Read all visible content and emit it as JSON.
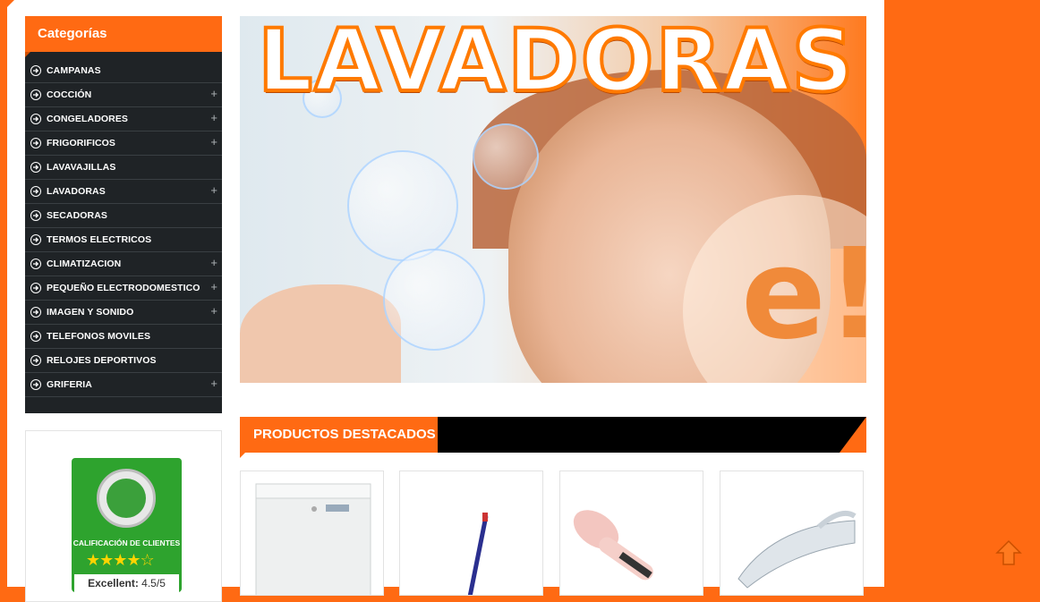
{
  "sidebar": {
    "title": "Categorías",
    "items": [
      {
        "label": "CAMPANAS",
        "expandable": false
      },
      {
        "label": "COCCIÓN",
        "expandable": true
      },
      {
        "label": "CONGELADORES",
        "expandable": true
      },
      {
        "label": "FRIGORIFICOS",
        "expandable": true
      },
      {
        "label": "LAVAVAJILLAS",
        "expandable": false
      },
      {
        "label": "LAVADORAS",
        "expandable": true
      },
      {
        "label": "SECADORAS",
        "expandable": false
      },
      {
        "label": "TERMOS ELECTRICOS",
        "expandable": false
      },
      {
        "label": "CLIMATIZACION",
        "expandable": true
      },
      {
        "label": "PEQUEÑO ELECTRODOMESTICO",
        "expandable": true
      },
      {
        "label": "IMAGEN Y SONIDO",
        "expandable": true
      },
      {
        "label": "TELEFONOS MOVILES",
        "expandable": false
      },
      {
        "label": "RELOJES DEPORTIVOS",
        "expandable": false
      },
      {
        "label": "GRIFERIA",
        "expandable": true
      }
    ],
    "plus_glyph": "+"
  },
  "ekomi": {
    "calificacion": "CALIFICACIÓN DE CLIENTES",
    "stars": "★★★★☆",
    "rating_text": "Excellent:",
    "rating_value": "4.5",
    "rating_max": "/5"
  },
  "banner": {
    "title": "LAVADORAS",
    "logo_letter": "e!"
  },
  "featured": {
    "title": "PRODUCTOS DESTACADOS"
  },
  "colors": {
    "accent": "#ff6a13",
    "sidebar_bg": "#1f2326",
    "ekomi_green": "#2ea32e"
  }
}
